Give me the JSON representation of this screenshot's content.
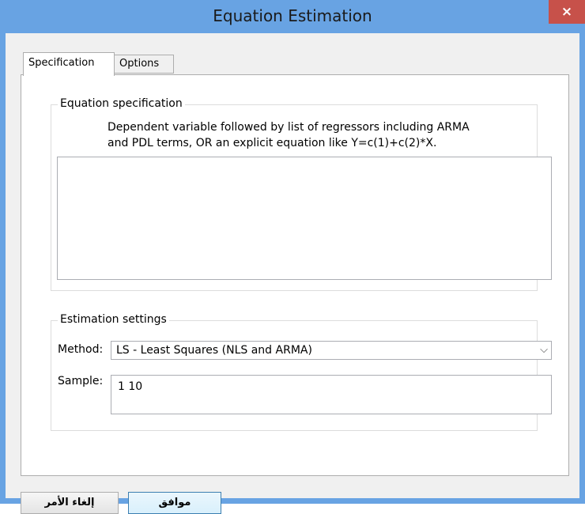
{
  "window": {
    "title": "Equation Estimation",
    "close_glyph": "×"
  },
  "tabs": [
    {
      "label": "Specification",
      "active": true
    },
    {
      "label": "Options",
      "active": false
    }
  ],
  "equation_spec": {
    "group_title": "Equation specification",
    "description_line1": "Dependent variable followed by list of regressors including ARMA",
    "description_line2": "and PDL terms, OR an explicit equation like Y=c(1)+c(2)*X.",
    "value": ""
  },
  "estimation": {
    "group_title": "Estimation settings",
    "method_label": "Method:",
    "method_value": "LS  - Least Squares (NLS and ARMA)",
    "sample_label": "Sample:",
    "sample_value": "1 10"
  },
  "buttons": {
    "cancel_label": "إلغاء الأمر",
    "ok_label": "موافق"
  },
  "icons": {
    "dropdown": "chevron-down-icon",
    "close": "close-icon"
  },
  "colors": {
    "titlebar": "#68a3e3",
    "close_button": "#c7514a"
  }
}
